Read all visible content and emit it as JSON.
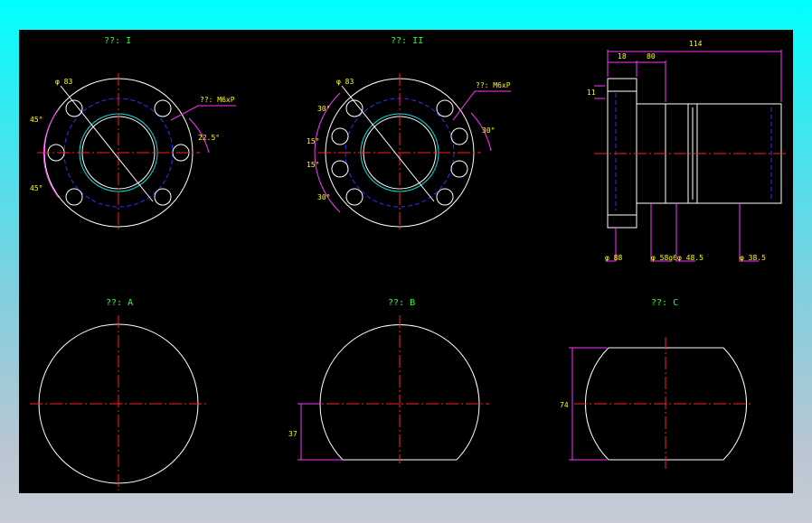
{
  "views": {
    "v1": {
      "title": "??: I"
    },
    "v2": {
      "title": "??: II"
    },
    "v3": {
      "title": "??: A"
    },
    "v4": {
      "title": "??: B"
    },
    "v5": {
      "title": "??: C"
    }
  },
  "dims": {
    "v1_pcd": "φ 83",
    "v1_hole": "??: M6xP",
    "v1_ang_top": "45°",
    "v1_ang_bot": "45°",
    "v1_right": "22.5°",
    "v2_pcd": "φ 83",
    "v2_hole": "??: M6xP",
    "v2_a1": "30°",
    "v2_a2": "15°",
    "v2_a3": "15°",
    "v2_a4": "30°",
    "v2_right": "30°",
    "side_total": "114",
    "side_d1": "18",
    "side_d2": "80",
    "side_t": "11",
    "side_b1": "φ 88",
    "side_b2": "φ 58g6",
    "side_b3": "φ 48.5",
    "side_b4": "φ 38.5",
    "b_flat": "37",
    "c_width": "74"
  },
  "colors": {
    "line": "#ffffff",
    "center": "#ff2020",
    "hidden": "#3030ff",
    "dimension": "#ff33ff",
    "label": "#ffff00",
    "title": "#33ff33"
  }
}
